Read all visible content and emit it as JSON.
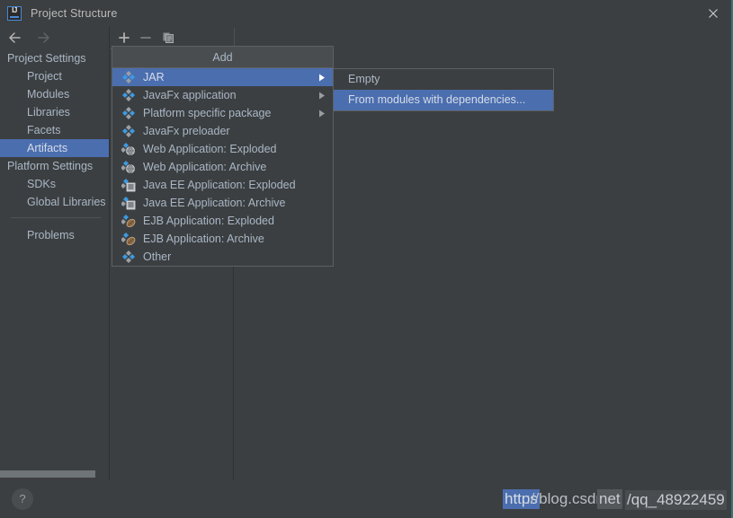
{
  "window": {
    "title": "Project Structure",
    "logo_icon": "intellij-idea-logo",
    "close_icon": "close-icon"
  },
  "navigation": {
    "back_icon": "arrow-left-icon",
    "forward_icon": "arrow-right-icon"
  },
  "toolbar": {
    "add_icon": "plus-icon",
    "remove_icon": "minus-icon",
    "copy_icon": "copy-icon"
  },
  "sidebar": {
    "groups": [
      {
        "label": "Project Settings",
        "items": [
          {
            "label": "Project",
            "selected": false
          },
          {
            "label": "Modules",
            "selected": false
          },
          {
            "label": "Libraries",
            "selected": false
          },
          {
            "label": "Facets",
            "selected": false
          },
          {
            "label": "Artifacts",
            "selected": true
          }
        ]
      },
      {
        "label": "Platform Settings",
        "items": [
          {
            "label": "SDKs",
            "selected": false
          },
          {
            "label": "Global Libraries",
            "selected": false
          }
        ]
      }
    ],
    "problems_label": "Problems"
  },
  "add_menu": {
    "header": "Add",
    "items": [
      {
        "label": "JAR",
        "icon": "artifact-jar-icon",
        "has_submenu": true,
        "selected": true
      },
      {
        "label": "JavaFx application",
        "icon": "artifact-javafx-icon",
        "has_submenu": true,
        "selected": false
      },
      {
        "label": "Platform specific package",
        "icon": "artifact-platform-icon",
        "has_submenu": true,
        "selected": false
      },
      {
        "label": "JavaFx preloader",
        "icon": "artifact-javafx-preloader-icon",
        "has_submenu": false,
        "selected": false
      },
      {
        "label": "Web Application: Exploded",
        "icon": "artifact-web-exploded-icon",
        "has_submenu": false,
        "selected": false
      },
      {
        "label": "Web Application: Archive",
        "icon": "artifact-web-archive-icon",
        "has_submenu": false,
        "selected": false
      },
      {
        "label": "Java EE Application: Exploded",
        "icon": "artifact-javaee-exploded-icon",
        "has_submenu": false,
        "selected": false
      },
      {
        "label": "Java EE Application: Archive",
        "icon": "artifact-javaee-archive-icon",
        "has_submenu": false,
        "selected": false
      },
      {
        "label": "EJB Application: Exploded",
        "icon": "artifact-ejb-exploded-icon",
        "has_submenu": false,
        "selected": false
      },
      {
        "label": "EJB Application: Archive",
        "icon": "artifact-ejb-archive-icon",
        "has_submenu": false,
        "selected": false
      },
      {
        "label": "Other",
        "icon": "artifact-other-icon",
        "has_submenu": false,
        "selected": false
      }
    ]
  },
  "jar_submenu": {
    "items": [
      {
        "label": "Empty",
        "selected": false
      },
      {
        "label": "From modules with dependencies...",
        "selected": true
      }
    ]
  },
  "bottom": {
    "help_label": "?"
  },
  "watermark": {
    "part_a": "https",
    "part_b": "://blog.csdn.",
    "part_c": "net",
    "part_d": "/qq_48922459"
  },
  "colors": {
    "background": "#3c3f41",
    "selection": "#4b6eaf",
    "text": "#a9b7c6",
    "menu_header": "#4a4d4f",
    "border": "#5e6060",
    "accent_edge": "#2b7a78"
  }
}
